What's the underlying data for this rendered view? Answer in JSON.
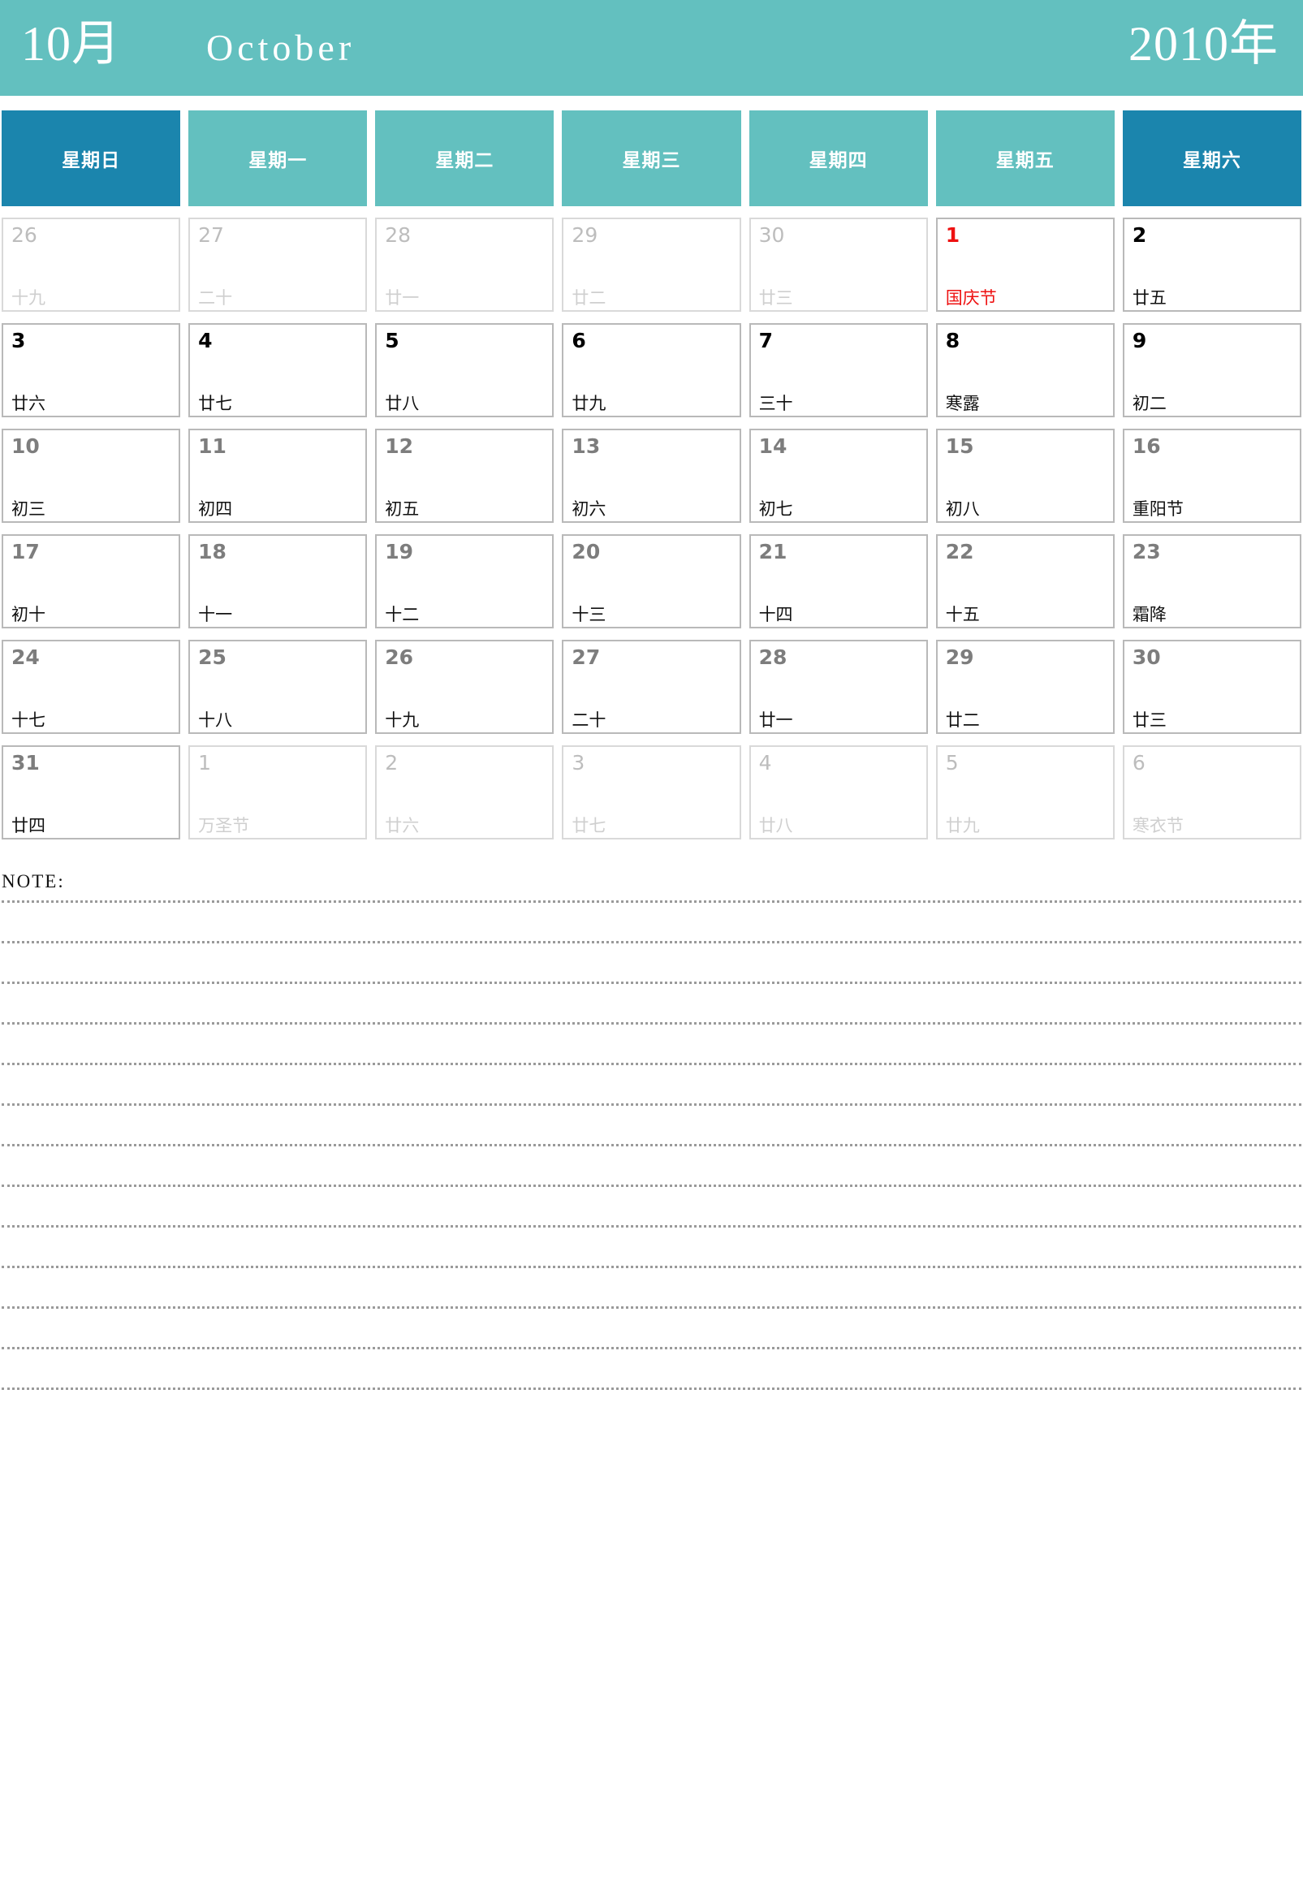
{
  "header": {
    "month_cn": "10月",
    "month_en": "October",
    "year_cn": "2010年",
    "bg_color": "#63c0bf",
    "text_color": "#ffffff"
  },
  "weekdays": [
    {
      "label": "星期日",
      "type": "weekend",
      "color": "#1b85ad"
    },
    {
      "label": "星期一",
      "type": "weekday",
      "color": "#63c0bf"
    },
    {
      "label": "星期二",
      "type": "weekday",
      "color": "#63c0bf"
    },
    {
      "label": "星期三",
      "type": "weekday",
      "color": "#63c0bf"
    },
    {
      "label": "星期四",
      "type": "weekday",
      "color": "#63c0bf"
    },
    {
      "label": "星期五",
      "type": "weekday",
      "color": "#63c0bf"
    },
    {
      "label": "星期六",
      "type": "weekend",
      "color": "#1b85ad"
    }
  ],
  "weeks": [
    [
      {
        "num": "26",
        "lunar": "十九",
        "state": "muted"
      },
      {
        "num": "27",
        "lunar": "二十",
        "state": "muted"
      },
      {
        "num": "28",
        "lunar": "廿一",
        "state": "muted"
      },
      {
        "num": "29",
        "lunar": "廿二",
        "state": "muted"
      },
      {
        "num": "30",
        "lunar": "廿三",
        "state": "muted"
      },
      {
        "num": "1",
        "lunar": "国庆节",
        "state": "holiday"
      },
      {
        "num": "2",
        "lunar": "廿五",
        "state": "strong"
      }
    ],
    [
      {
        "num": "3",
        "lunar": "廿六",
        "state": "strong"
      },
      {
        "num": "4",
        "lunar": "廿七",
        "state": "strong"
      },
      {
        "num": "5",
        "lunar": "廿八",
        "state": "strong"
      },
      {
        "num": "6",
        "lunar": "廿九",
        "state": "strong"
      },
      {
        "num": "7",
        "lunar": "三十",
        "state": "strong"
      },
      {
        "num": "8",
        "lunar": "寒露",
        "state": "strong"
      },
      {
        "num": "9",
        "lunar": "初二",
        "state": "strong"
      }
    ],
    [
      {
        "num": "10",
        "lunar": "初三",
        "state": "normal"
      },
      {
        "num": "11",
        "lunar": "初四",
        "state": "normal"
      },
      {
        "num": "12",
        "lunar": "初五",
        "state": "normal"
      },
      {
        "num": "13",
        "lunar": "初六",
        "state": "normal"
      },
      {
        "num": "14",
        "lunar": "初七",
        "state": "normal"
      },
      {
        "num": "15",
        "lunar": "初八",
        "state": "normal"
      },
      {
        "num": "16",
        "lunar": "重阳节",
        "state": "normal"
      }
    ],
    [
      {
        "num": "17",
        "lunar": "初十",
        "state": "normal"
      },
      {
        "num": "18",
        "lunar": "十一",
        "state": "normal"
      },
      {
        "num": "19",
        "lunar": "十二",
        "state": "normal"
      },
      {
        "num": "20",
        "lunar": "十三",
        "state": "normal"
      },
      {
        "num": "21",
        "lunar": "十四",
        "state": "normal"
      },
      {
        "num": "22",
        "lunar": "十五",
        "state": "normal"
      },
      {
        "num": "23",
        "lunar": "霜降",
        "state": "normal"
      }
    ],
    [
      {
        "num": "24",
        "lunar": "十七",
        "state": "normal"
      },
      {
        "num": "25",
        "lunar": "十八",
        "state": "normal"
      },
      {
        "num": "26",
        "lunar": "十九",
        "state": "normal"
      },
      {
        "num": "27",
        "lunar": "二十",
        "state": "normal"
      },
      {
        "num": "28",
        "lunar": "廿一",
        "state": "normal"
      },
      {
        "num": "29",
        "lunar": "廿二",
        "state": "normal"
      },
      {
        "num": "30",
        "lunar": "廿三",
        "state": "normal"
      }
    ],
    [
      {
        "num": "31",
        "lunar": "廿四",
        "state": "normal"
      },
      {
        "num": "1",
        "lunar": "万圣节",
        "state": "muted"
      },
      {
        "num": "2",
        "lunar": "廿六",
        "state": "muted"
      },
      {
        "num": "3",
        "lunar": "廿七",
        "state": "muted"
      },
      {
        "num": "4",
        "lunar": "廿八",
        "state": "muted"
      },
      {
        "num": "5",
        "lunar": "廿九",
        "state": "muted"
      },
      {
        "num": "6",
        "lunar": "寒衣节",
        "state": "muted"
      }
    ]
  ],
  "notes": {
    "label": "NOTE:",
    "line_count": 13
  }
}
